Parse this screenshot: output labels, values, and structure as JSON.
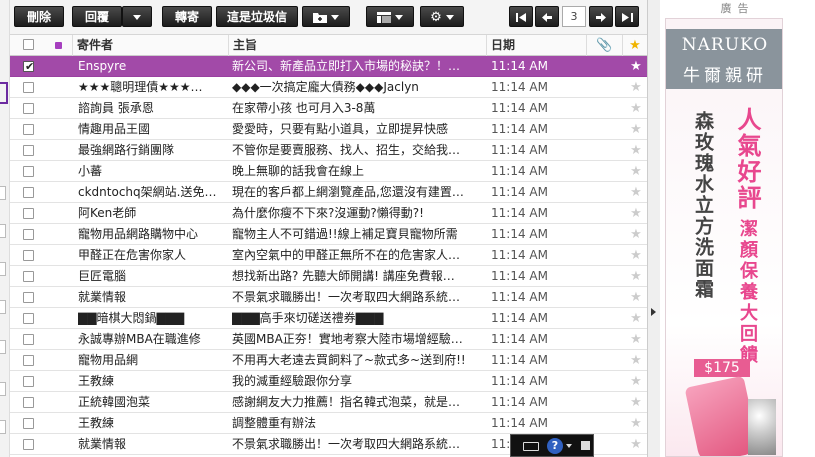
{
  "toolbar": {
    "delete": "刪除",
    "reply": "回覆",
    "forward": "轉寄",
    "spam": "這是垃圾信",
    "page_number": "3"
  },
  "header": {
    "from": "寄件者",
    "subject": "主旨",
    "date": "日期"
  },
  "colors": {
    "selected_row": "#a24aa8",
    "star_header": "#f0b400",
    "toolbar_button": "#2a2a2a"
  },
  "messages": [
    {
      "from": "Enspyre",
      "subject": "新公司、新產品立即打入市場的秘訣？！…",
      "date": "11:14 AM",
      "selected": true
    },
    {
      "from": "★★★聰明理債★★★…",
      "subject": "◆◆◆一次搞定龐大債務◆◆◆Jaclyn",
      "date": "11:14 AM"
    },
    {
      "from": "諮詢員 張承恩",
      "subject": "在家帶小孩 也可月入3-8萬",
      "date": "11:14 AM"
    },
    {
      "from": "情趣用品王國",
      "subject": "愛愛時，只要有點小道具，立即提昇快感",
      "date": "11:14 AM"
    },
    {
      "from": "最強網路行銷團隊",
      "subject": "不管你是要賣服務、找人、招生，交給我…",
      "date": "11:14 AM"
    },
    {
      "from": "小蕃",
      "subject": "晚上無聊的話我會在線上",
      "date": "11:14 AM"
    },
    {
      "from": "ckdntochq架網站.送免…",
      "subject": "現在的客戶都上網瀏覽產品,您還沒有建置…",
      "date": "11:14 AM"
    },
    {
      "from": "阿Ken老師",
      "subject": "為什麼你瘦不下來?沒運動?懶得動?!",
      "date": "11:14 AM"
    },
    {
      "from": "寵物用品網路購物中心",
      "subject": "寵物主人不可錯過!!線上補足寶貝寵物所需",
      "date": "11:14 AM"
    },
    {
      "from": "甲醛正在危害你家人",
      "subject": "室內空氣中的甲醛正無所不在的危害家人…",
      "date": "11:14 AM"
    },
    {
      "from": "巨匠電腦",
      "subject": "想找新出路? 先聽大師開講! 講座免費報…",
      "date": "11:14 AM"
    },
    {
      "from": "就業情報",
      "subject": "不景氣求職勝出！一次考取四大網路系統…",
      "date": "11:14 AM"
    },
    {
      "from": "▇▇暗棋大悶鍋▇▇▇",
      "subject": "▇▇▇高手來切磋送禮券▇▇▇",
      "date": "11:14 AM"
    },
    {
      "from": "永誠專辦MBA在職進修",
      "subject": "英國MBA正夯！實地考察大陸市場增經驗…",
      "date": "11:14 AM"
    },
    {
      "from": "寵物用品網",
      "subject": "不用再大老遠去買飼料了~款式多~送到府!!",
      "date": "11:14 AM"
    },
    {
      "from": "王教練",
      "subject": "我的減重經驗跟你分享",
      "date": "11:14 AM"
    },
    {
      "from": "正統韓國泡菜",
      "subject": "感謝網友大力推薦！指名韓式泡菜，就是…",
      "date": "11:14 AM"
    },
    {
      "from": "王教練",
      "subject": "調整體重有辦法",
      "date": "11:14 AM"
    },
    {
      "from": "就業情報",
      "subject": "不景氣求職勝出！一次考取四大網路系統…",
      "date": "11:14 AM"
    }
  ],
  "ad": {
    "label": "廣告",
    "brand_en": "NARUKO",
    "brand_zh": "牛爾親研",
    "line1": "森玫瑰水立方洗面霜",
    "line2": "人氣好評",
    "line3": "潔顏保養大回饋",
    "price": "$175"
  }
}
